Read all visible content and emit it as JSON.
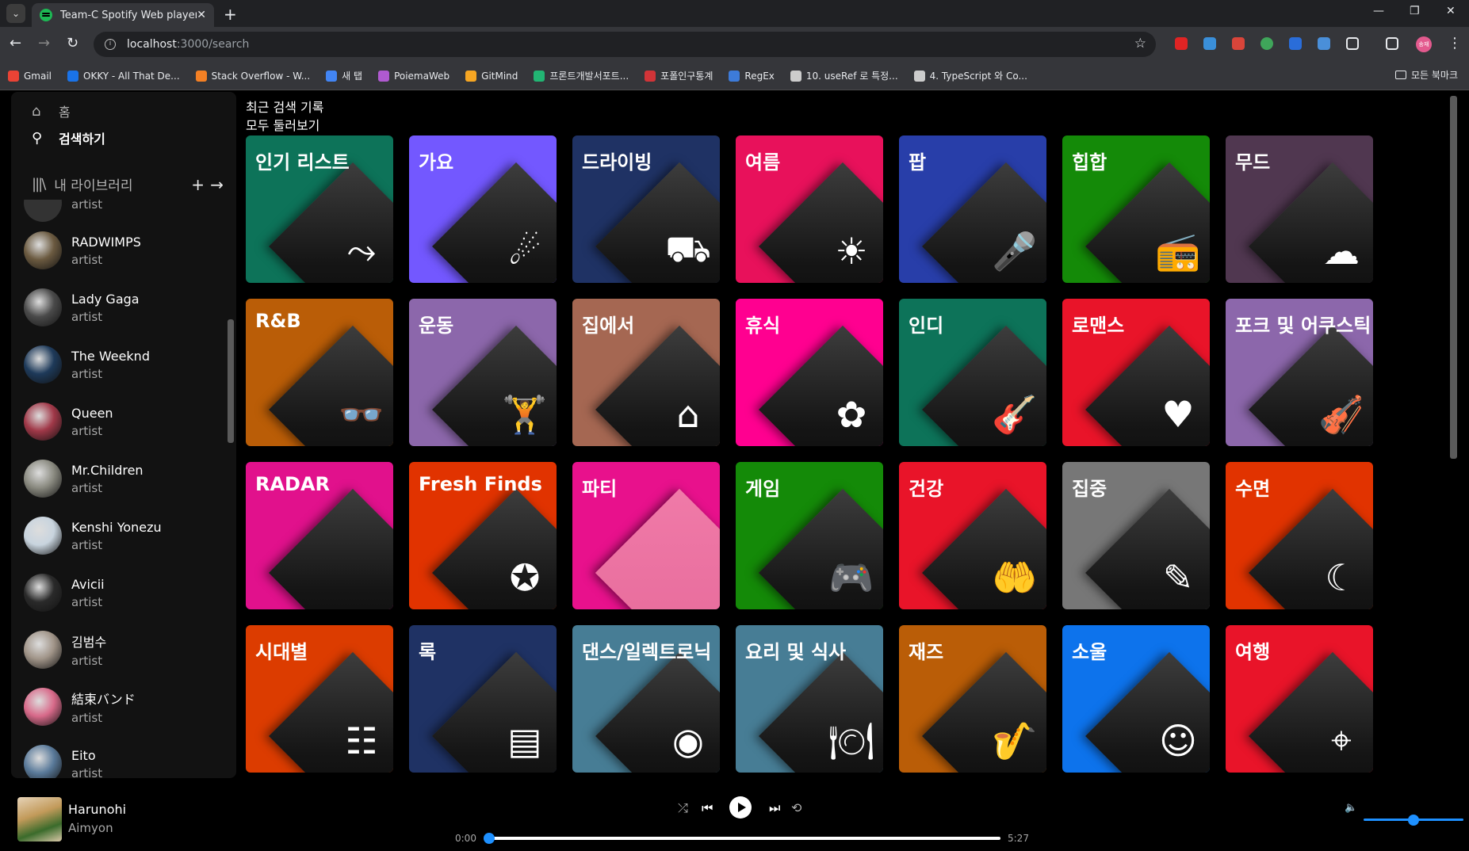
{
  "browser": {
    "tab_title": "Team-C Spotify Web player",
    "url_host": "localhost",
    "url_path": ":3000/search",
    "bookmarks": [
      {
        "label": "Gmail",
        "color": "#ea4335"
      },
      {
        "label": "OKKY - All That De...",
        "color": "#1a73e8"
      },
      {
        "label": "Stack Overflow - W...",
        "color": "#f48024"
      },
      {
        "label": "새 탭",
        "color": "#4285f4"
      },
      {
        "label": "PoiemaWeb",
        "color": "#b05ad0"
      },
      {
        "label": "GitMind",
        "color": "#f6a623"
      },
      {
        "label": "프론트개발서포트...",
        "color": "#22b573"
      },
      {
        "label": "포폴인구통계",
        "color": "#d13438"
      },
      {
        "label": "RegEx",
        "color": "#3d7bd9"
      },
      {
        "label": "10. useRef 로 특정...",
        "color": "#cccccc"
      },
      {
        "label": "4. TypeScript 와 Co...",
        "color": "#cccccc"
      }
    ],
    "all_bookmarks": "모든 북마크",
    "profile": "송재"
  },
  "sidebar": {
    "home": "홈",
    "search": "검색하기",
    "library": "내 라이브러리",
    "partial_top": "artist",
    "artists": [
      {
        "name": "RADWIMPS",
        "type": "artist",
        "color": "#6b5a40"
      },
      {
        "name": "Lady Gaga",
        "type": "artist",
        "color": "#4a4a4a"
      },
      {
        "name": "The Weeknd",
        "type": "artist",
        "color": "#1e3a5a"
      },
      {
        "name": "Queen",
        "type": "artist",
        "color": "#a03848"
      },
      {
        "name": "Mr.Children",
        "type": "artist",
        "color": "#8a8a80"
      },
      {
        "name": "Kenshi Yonezu",
        "type": "artist",
        "color": "#c8d4de"
      },
      {
        "name": "Avicii",
        "type": "artist",
        "color": "#2a2a2a"
      },
      {
        "name": "김범수",
        "type": "artist",
        "color": "#a09488"
      },
      {
        "name": "結束バンド",
        "type": "artist",
        "color": "#d86a8a"
      },
      {
        "name": "Eito",
        "type": "artist",
        "color": "#5a7a9a"
      }
    ]
  },
  "main": {
    "recent_search": "최근 검색 기록",
    "browse_all": "모두 둘러보기",
    "categories": [
      {
        "label": "인기 리스트",
        "color": "#0d7359",
        "glyph": "⤳",
        "icon": "trending-icon"
      },
      {
        "label": "가요",
        "color": "#7358ff",
        "glyph": "☄",
        "icon": "comet-icon"
      },
      {
        "label": "드라이빙",
        "color": "#1f3264",
        "glyph": "⛟",
        "icon": "car-icon"
      },
      {
        "label": "여름",
        "color": "#e8115b",
        "glyph": "☀",
        "icon": "sun-icon"
      },
      {
        "label": "팝",
        "color": "#283ea9",
        "glyph": "🎤",
        "icon": "microphone-icon"
      },
      {
        "label": "힙합",
        "color": "#148a08",
        "glyph": "📻",
        "icon": "boombox-icon"
      },
      {
        "label": "무드",
        "color": "#503750",
        "glyph": "☁",
        "icon": "cloud-icon"
      },
      {
        "label": "R&B",
        "color": "#ba5d07",
        "glyph": "👓",
        "icon": "glasses-icon"
      },
      {
        "label": "운동",
        "color": "#8c67ab",
        "glyph": "🏋",
        "icon": "dumbbell-icon"
      },
      {
        "label": "집에서",
        "color": "#a56752",
        "glyph": "⌂",
        "icon": "house-icon"
      },
      {
        "label": "휴식",
        "color": "#ff0090",
        "glyph": "✿",
        "icon": "lotus-icon"
      },
      {
        "label": "인디",
        "color": "#0d7359",
        "glyph": "🎸",
        "icon": "guitar-icon"
      },
      {
        "label": "로맨스",
        "color": "#e91429",
        "glyph": "♥",
        "icon": "heart-icon"
      },
      {
        "label": "포크 및 어쿠스틱",
        "color": "#8c67ab",
        "glyph": "🎻",
        "icon": "mandolin-icon"
      },
      {
        "label": "RADAR",
        "color": "#e1118c",
        "glyph": "",
        "icon": "radar-icon"
      },
      {
        "label": "Fresh Finds",
        "color": "#e13300",
        "glyph": "✪",
        "icon": "star-badge-icon"
      },
      {
        "label": "파티",
        "color": "#e8118c",
        "glyph": "",
        "icon": "party-icon"
      },
      {
        "label": "게임",
        "color": "#148a08",
        "glyph": "🎮",
        "icon": "gamepad-icon"
      },
      {
        "label": "건강",
        "color": "#e91429",
        "glyph": "🤲",
        "icon": "hands-heart-icon"
      },
      {
        "label": "집중",
        "color": "#777777",
        "glyph": "✎",
        "icon": "pen-icon"
      },
      {
        "label": "수면",
        "color": "#e13300",
        "glyph": "☾",
        "icon": "bed-moon-icon"
      },
      {
        "label": "시대별",
        "color": "#dc3c00",
        "glyph": "☷",
        "icon": "calendar-icon"
      },
      {
        "label": "록",
        "color": "#1f3264",
        "glyph": "▤",
        "icon": "amp-icon"
      },
      {
        "label": "댄스/일렉트로닉",
        "color": "#477d95",
        "glyph": "◉",
        "icon": "turntable-icon"
      },
      {
        "label": "요리 및 식사",
        "color": "#477d95",
        "glyph": "🍽",
        "icon": "plate-icon"
      },
      {
        "label": "재즈",
        "color": "#ba5d07",
        "glyph": "🎷",
        "icon": "saxophone-icon"
      },
      {
        "label": "소울",
        "color": "#0d73ec",
        "glyph": "☺",
        "icon": "face-icon"
      },
      {
        "label": "여행",
        "color": "#e91429",
        "glyph": "⌖",
        "icon": "map-pin-icon"
      }
    ]
  },
  "player": {
    "title": "Harunohi",
    "artist": "Aimyon",
    "current_time": "0:00",
    "duration": "5:27",
    "progress": 0,
    "volume": 0.5
  }
}
